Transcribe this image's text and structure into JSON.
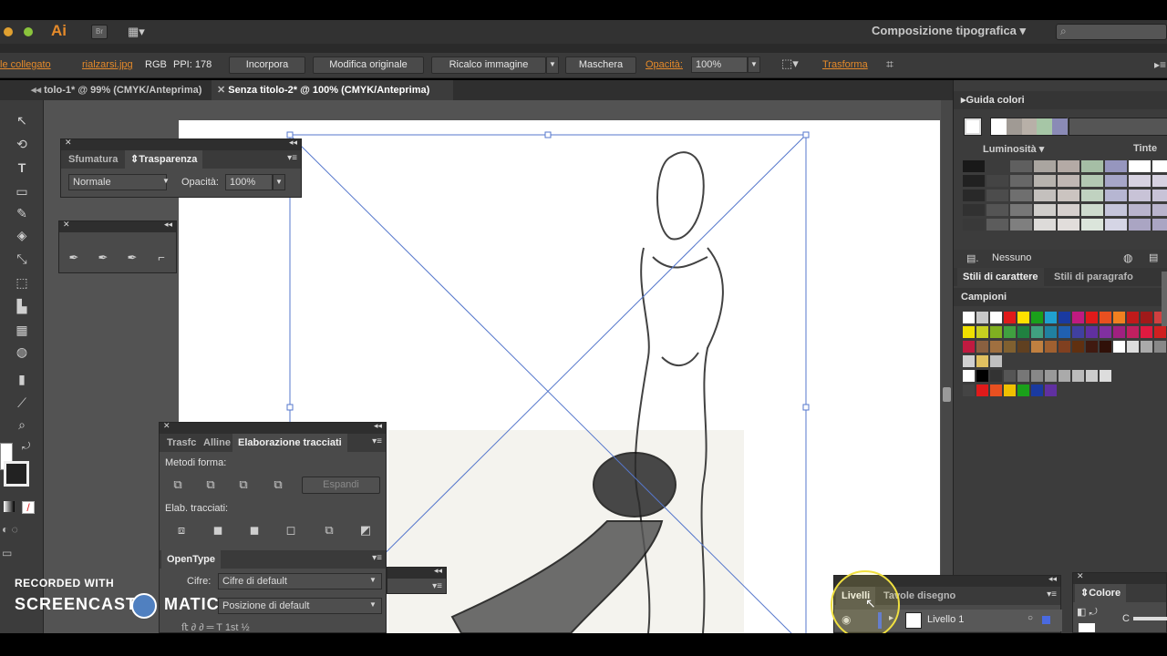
{
  "app": {
    "logo": "Ai",
    "workspace": "Composizione tipografica",
    "search_icon": "search-icon"
  },
  "control_bar": {
    "linked_file_status": "le collegato",
    "file_name": "rialzarsi.jpg",
    "color_mode": "RGB",
    "ppi": "PPI: 178",
    "embed_btn": "Incorpora",
    "edit_original_btn": "Modifica originale",
    "image_trace_btn": "Ricalco immagine",
    "mask_btn": "Maschera",
    "opacity_label": "Opacità:",
    "opacity_value": "100%",
    "transform_link": "Trasforma"
  },
  "document_tabs": [
    {
      "label": "tolo-1* @ 99% (CMYK/Anteprima)",
      "active": false
    },
    {
      "label": "Senza titolo-2* @ 100% (CMYK/Anteprima)",
      "active": true
    }
  ],
  "transparency_panel": {
    "tabs": [
      "Sfumatura",
      "Trasparenza"
    ],
    "blend_mode": "Normale",
    "opacity_label": "Opacità:",
    "opacity_value": "100%"
  },
  "pathfinder_panel": {
    "tabs": [
      "Trasfc",
      "Alline",
      "Elaborazione tracciati"
    ],
    "shape_modes_label": "Metodi forma:",
    "expand_btn": "Espandi",
    "pathfinders_label": "Elab. tracciati:"
  },
  "opentype_panel": {
    "title": "OpenType",
    "figures_label": "Cifre:",
    "figures_value": "Cifre di default",
    "position_value": "Posizione di default"
  },
  "color_guide": {
    "title": "Guida colori",
    "luminosity_label": "Luminosità",
    "tints_label": "Tinte",
    "none_label": "Nessuno",
    "harmony_colors": [
      "#ffffff",
      "#a09a94",
      "#b8b0a8",
      "#a6c6a6",
      "#8a8ab6"
    ]
  },
  "styles_tabs": [
    "Stili di carattere",
    "Stili di paragrafo"
  ],
  "swatches": {
    "title": "Campioni"
  },
  "layers_panel": {
    "tabs": [
      "Livelli",
      "Tavole disegno"
    ],
    "layer_name": "Livello 1"
  },
  "color_panel": {
    "title": "Colore",
    "channel": "C"
  },
  "watermark": {
    "line1": "RECORDED WITH",
    "line2a": "SCREENCAST",
    "line2b": "MATIC"
  }
}
